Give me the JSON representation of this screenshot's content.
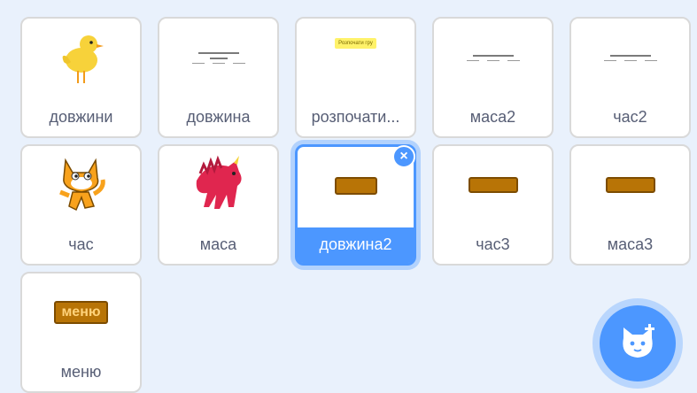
{
  "sprites": [
    {
      "name": "довжини",
      "thumb": "chick-icon"
    },
    {
      "name": "довжина",
      "thumb": "doc-lines"
    },
    {
      "name": "розпочати...",
      "thumb": "yellow-button",
      "thumb_text": "Розпочати гру"
    },
    {
      "name": "маса2",
      "thumb": "doc-lines"
    },
    {
      "name": "час2",
      "thumb": "doc-lines"
    },
    {
      "name": "час",
      "thumb": "cat-icon"
    },
    {
      "name": "маса",
      "thumb": "dinosaur-icon"
    },
    {
      "name": "довжина2",
      "thumb": "brown-button",
      "selected": true,
      "delete_symbol": "×"
    },
    {
      "name": "час3",
      "thumb": "brown-button"
    },
    {
      "name": "маса3",
      "thumb": "brown-button"
    },
    {
      "name": "меню",
      "thumb": "menu-button",
      "thumb_text": "меню"
    }
  ],
  "fab": {
    "icon": "add-sprite-cat-icon"
  },
  "colors": {
    "accent": "#4c97ff",
    "background": "#e9f1fc",
    "label": "#575e75"
  }
}
